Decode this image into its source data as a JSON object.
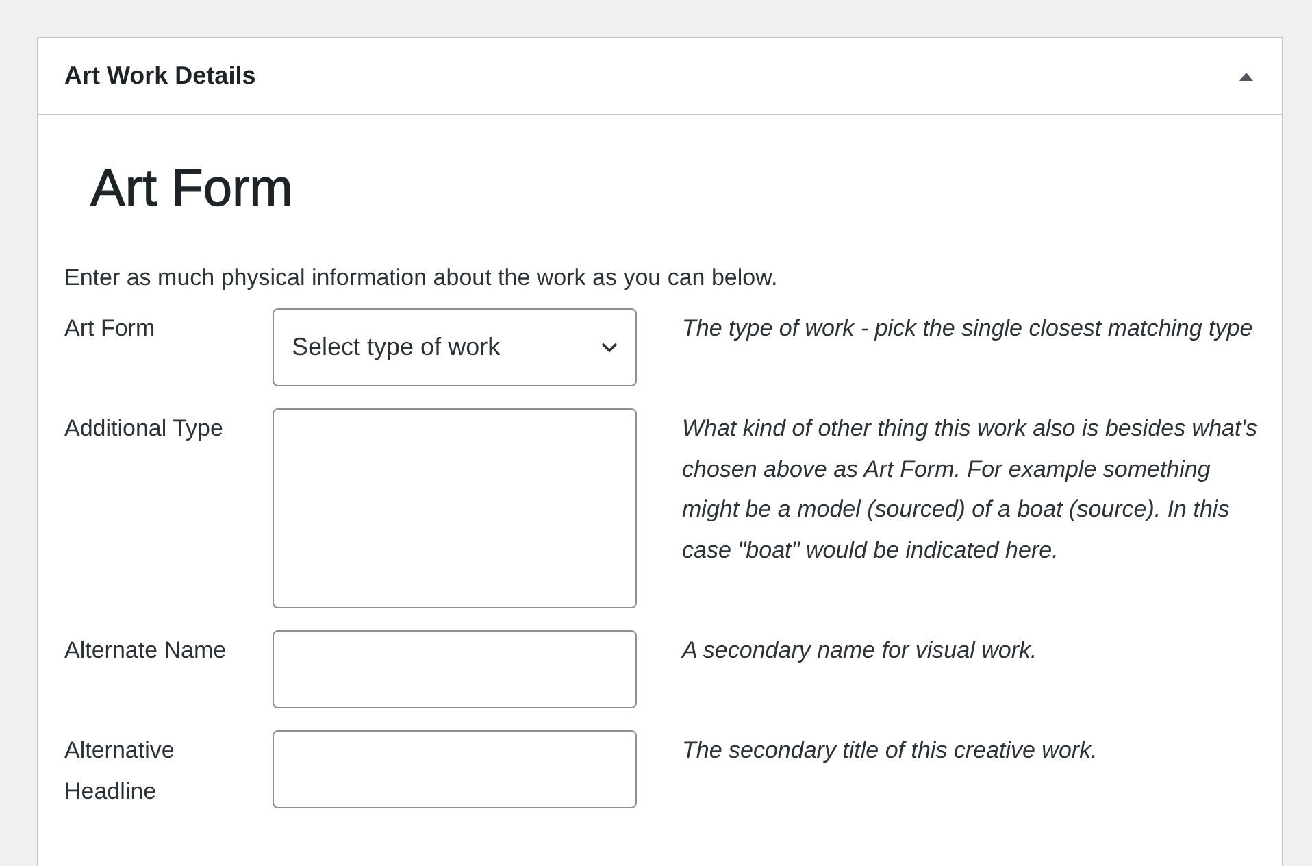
{
  "panel": {
    "title": "Art Work Details",
    "expanded": true
  },
  "heading": "Art Form",
  "intro": "Enter as much physical information about the work as you can below.",
  "fields": [
    {
      "kind": "select",
      "label": "Art Form",
      "value": "Select type of work",
      "description": "The type of work - pick the single closest matching type"
    },
    {
      "kind": "textarea",
      "label": "Additional Type",
      "description": "What kind of other thing this work also is besides what's chosen above as Art Form. For example something might be a model (sourced) of a boat (source). In this case \"boat\" would be indicated here."
    },
    {
      "kind": "input",
      "label": "Alternate Name",
      "description": "A secondary name for visual work."
    },
    {
      "kind": "input",
      "label": "Alternative Headline",
      "description": "The secondary title of this creative work."
    }
  ]
}
